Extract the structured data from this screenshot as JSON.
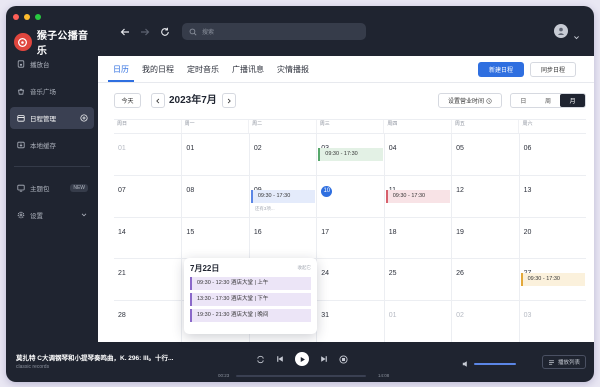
{
  "app": {
    "name": "猴子公播音乐"
  },
  "colors": {
    "accent": "#2f6fe0",
    "sidebar_bg": "#1f2430",
    "brand": "#e0463e"
  },
  "sidebar": {
    "items": [
      {
        "label": "播放台",
        "icon": "broadcast-icon",
        "active": false
      },
      {
        "label": "音乐广场",
        "icon": "music-plaza-icon",
        "active": false
      },
      {
        "label": "日程管理",
        "icon": "calendar-icon",
        "active": true
      },
      {
        "label": "本地缓存",
        "icon": "download-icon",
        "active": false
      },
      {
        "label": "主题包",
        "icon": "theme-icon",
        "badge": "NEW",
        "active": false
      },
      {
        "label": "设置",
        "icon": "gear-icon",
        "active": false
      }
    ]
  },
  "topbar": {
    "search_placeholder": "搜索"
  },
  "tabs": [
    "日历",
    "我的日程",
    "定时音乐",
    "广播讯息",
    "灾情播报"
  ],
  "buttons": {
    "new_schedule": "新建日程",
    "sync_schedule": "同步日程",
    "today": "今天",
    "work_hours": "设置营业时间"
  },
  "calendar": {
    "title": "2023年7月",
    "views": [
      "日",
      "周",
      "月"
    ],
    "active_view": "月",
    "weekdays": [
      "周日",
      "周一",
      "周二",
      "周三",
      "周四",
      "周五",
      "周六"
    ],
    "weeks": [
      [
        "01",
        "01",
        "02",
        "03",
        "04",
        "05",
        "06"
      ],
      [
        "07",
        "08",
        "09",
        "10",
        "11",
        "12",
        "13"
      ],
      [
        "14",
        "15",
        "16",
        "17",
        "18",
        "19",
        "20"
      ],
      [
        "21",
        "22",
        "23",
        "24",
        "25",
        "26",
        "27"
      ],
      [
        "28",
        "29",
        "30",
        "31",
        "01",
        "02",
        "03"
      ]
    ],
    "events": {
      "d03": "09:30 - 17:30",
      "d09": "09:30 - 17:30",
      "d09_more": "还有3项...",
      "d11": "09:30 - 17:30",
      "d27": "09:30 - 17:30"
    }
  },
  "popover": {
    "title": "7月22日",
    "close": "收起它",
    "items": [
      "09:30 - 12:30    酒店大堂 | 上午",
      "13:30 - 17:30    酒店大堂 | 下午",
      "19:30 - 21:30    酒店大堂 | 晚间"
    ]
  },
  "player": {
    "song": "莫扎特 C大调钢琴和小提琴奏鸣曲，K. 296: III。十行...",
    "artist": "classic records",
    "time_current": "00:23",
    "time_total": "14:08",
    "playlist": "播放列表"
  }
}
